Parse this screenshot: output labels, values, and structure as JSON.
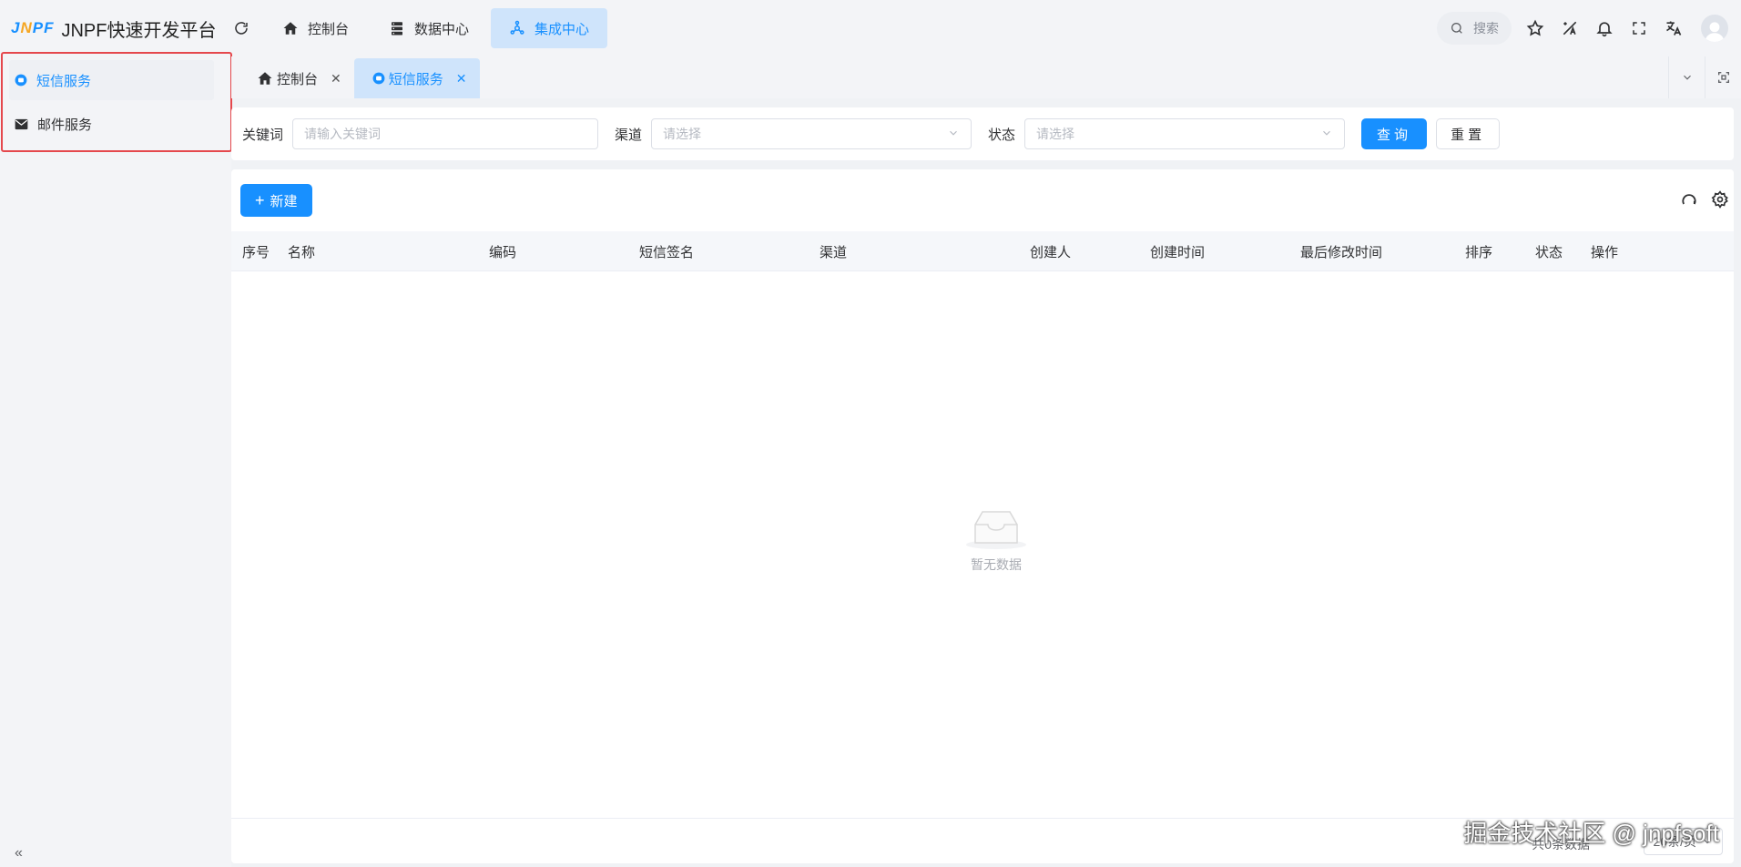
{
  "app": {
    "logo_mark": "JNPF",
    "title": "JNPF快速开发平台"
  },
  "topnav": {
    "items": [
      {
        "label": "控制台",
        "icon": "home-icon"
      },
      {
        "label": "数据中心",
        "icon": "database-icon"
      },
      {
        "label": "集成中心",
        "icon": "integration-icon",
        "active": true
      }
    ]
  },
  "header": {
    "search_label": "搜索"
  },
  "sidebar": {
    "items": [
      {
        "label": "短信服务",
        "icon": "sms-icon",
        "active": true
      },
      {
        "label": "邮件服务",
        "icon": "mail-icon"
      }
    ],
    "highlight_color": "#e5484d"
  },
  "tabs": [
    {
      "label": "控制台",
      "icon": "home-icon"
    },
    {
      "label": "短信服务",
      "icon": "sms-icon",
      "active": true
    }
  ],
  "filter": {
    "keyword_label": "关键词",
    "keyword_placeholder": "请输入关键词",
    "channel_label": "渠道",
    "channel_placeholder": "请选择",
    "status_label": "状态",
    "status_placeholder": "请选择",
    "query_button": "查询",
    "reset_button": "重置"
  },
  "toolbar": {
    "new_button": "新建"
  },
  "table": {
    "columns": [
      "序号",
      "名称",
      "编码",
      "短信签名",
      "渠道",
      "创建人",
      "创建时间",
      "最后修改时间",
      "排序",
      "状态",
      "操作"
    ],
    "rows": [],
    "empty_text": "暂无数据"
  },
  "pagination": {
    "total_text": "共0条数据",
    "page_size": "20条/页"
  },
  "watermark": "掘金技术社区 @ jnpfsoft",
  "colors": {
    "primary": "#1890ff",
    "active_bg": "#cfe4fb"
  }
}
